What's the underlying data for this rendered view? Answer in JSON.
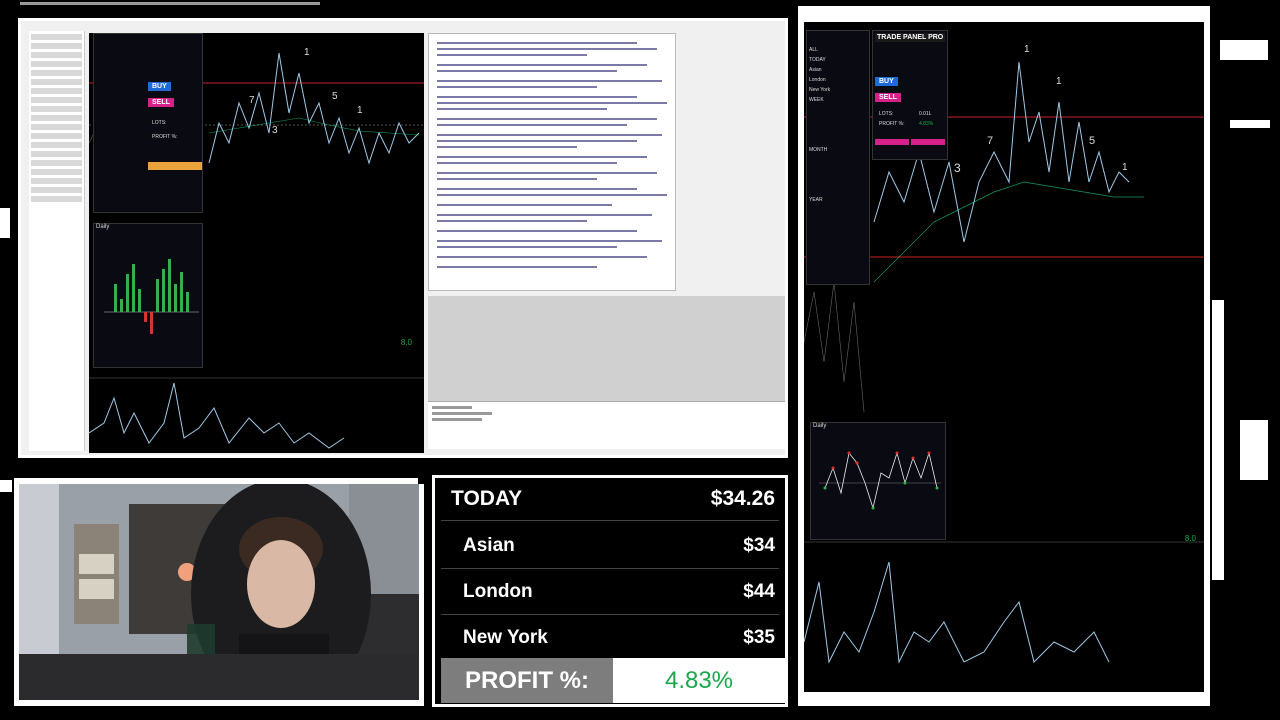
{
  "stats": {
    "today_label": "TODAY",
    "today_value": "$34.26",
    "sessions": [
      {
        "label": "Asian",
        "value": "$34"
      },
      {
        "label": "London",
        "value": "$44"
      },
      {
        "label": "New York",
        "value": "$35"
      }
    ],
    "profit_label": "PROFIT %:",
    "profit_value": "4.83%"
  },
  "left_chart": {
    "buy_label": "BUY",
    "sell_label": "SELL",
    "lots_label": "LOTS:",
    "profit_label": "PROFIT %:",
    "indicator_label": "Daily",
    "readout": "8.0"
  },
  "right_chart": {
    "panel_title": "TRADE PANEL PRO",
    "buy_label": "BUY",
    "sell_label": "SELL",
    "lots_label": "LOTS:",
    "lots_value": "0.01L",
    "profit_label": "PROFIT %:",
    "profit_value": "4.83%",
    "indicator_label": "Daily",
    "readout": "8.0",
    "summary_rows": [
      "ALL",
      "TODAY",
      "Asian",
      "London",
      "New York",
      "WEEK",
      "MONTH",
      "YEAR"
    ]
  },
  "colors": {
    "buy": "#1e6bd6",
    "sell": "#d6208a",
    "profit_green": "#1aa84a",
    "bar_green": "#33b04d",
    "bar_red": "#d63333",
    "candle": "#9ec9e6"
  }
}
